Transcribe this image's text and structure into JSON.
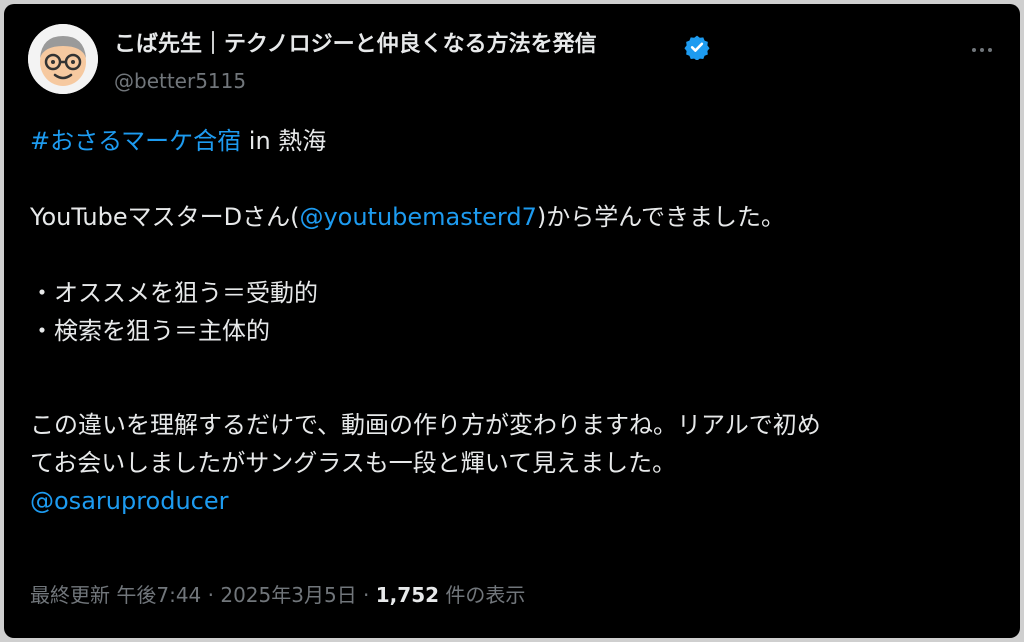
{
  "author": {
    "display_name": "こば先生｜テクノロジーと仲良くなる方法を発信",
    "handle": "@better5115",
    "verified": true
  },
  "tweet": {
    "line1_hashtag": "#おさるマーケ合宿",
    "line1_rest": " in 熱海",
    "line2_prefix": "YouTubeマスターDさん(",
    "line2_mention": "@youtubemasterd7",
    "line2_suffix": ")から学んできました。",
    "bullet1": "・オススメを狙う＝受動的",
    "bullet2": "・検索を狙う＝主体的",
    "para_line1": "この違いを理解するだけで、動画の作り方が変わりますね。リアルで初め",
    "para_line2": "てお会いしましたがサングラスも一段と輝いて見えました。",
    "closing_mention": "@osaruproducer"
  },
  "meta": {
    "prefix": "最終更新 午後7:44 · 2025年3月5日 · ",
    "views_count": "1,752",
    "views_label": " 件の表示"
  },
  "colors": {
    "background": "#000000",
    "text": "#e7e9ea",
    "muted": "#71767b",
    "link": "#1d9bf0"
  },
  "icons": {
    "verified": "verified-badge-icon",
    "more": "more-options-icon"
  }
}
